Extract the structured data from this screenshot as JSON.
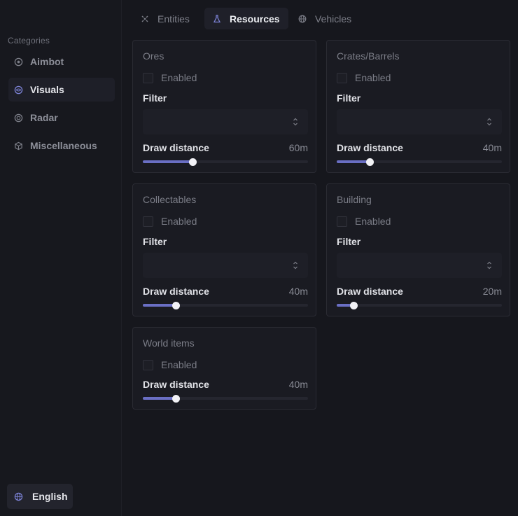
{
  "sidebar": {
    "heading": "Categories",
    "items": [
      {
        "label": "Aimbot",
        "icon": "crosshair-icon"
      },
      {
        "label": "Visuals",
        "icon": "eye-icon"
      },
      {
        "label": "Radar",
        "icon": "radar-icon"
      },
      {
        "label": "Miscellaneous",
        "icon": "cube-icon"
      }
    ],
    "active_index": 1,
    "language": "English"
  },
  "tabs": [
    {
      "label": "Entities",
      "icon": "users-icon"
    },
    {
      "label": "Resources",
      "icon": "flask-icon"
    },
    {
      "label": "Vehicles",
      "icon": "globe-icon"
    }
  ],
  "active_tab": 1,
  "cards": [
    {
      "title": "Ores",
      "enabled_label": "Enabled",
      "enabled": false,
      "filter_label": "Filter",
      "distance_label": "Draw distance",
      "distance_value": "60m",
      "slider_fraction": 0.3
    },
    {
      "title": "Crates/Barrels",
      "enabled_label": "Enabled",
      "enabled": false,
      "filter_label": "Filter",
      "distance_label": "Draw distance",
      "distance_value": "40m",
      "slider_fraction": 0.2
    },
    {
      "title": "Collectables",
      "enabled_label": "Enabled",
      "enabled": false,
      "filter_label": "Filter",
      "distance_label": "Draw distance",
      "distance_value": "40m",
      "slider_fraction": 0.2
    },
    {
      "title": "Building",
      "enabled_label": "Enabled",
      "enabled": false,
      "filter_label": "Filter",
      "distance_label": "Draw distance",
      "distance_value": "20m",
      "slider_fraction": 0.1
    },
    {
      "title": "World items",
      "enabled_label": "Enabled",
      "enabled": false,
      "distance_label": "Draw distance",
      "distance_value": "40m",
      "slider_fraction": 0.2
    }
  ],
  "colors": {
    "accent": "#6a6fc4",
    "background": "#16171d",
    "card": "#1a1b22"
  }
}
